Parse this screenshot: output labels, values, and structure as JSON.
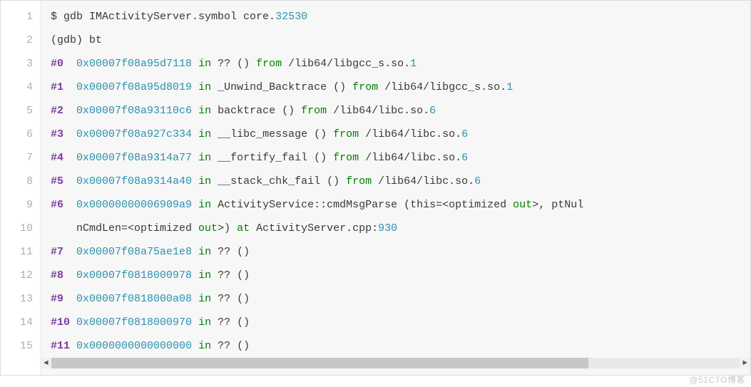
{
  "watermark": "@51CTO博客",
  "gutter": [
    "1",
    "2",
    "3",
    "4",
    "5",
    "6",
    "7",
    "8",
    "9",
    "10",
    "11",
    "12",
    "13",
    "14",
    "15"
  ],
  "lines": [
    {
      "tokens": [
        {
          "cls": "tok-plain",
          "txt": "$ gdb IMActivityServer.symbol core."
        },
        {
          "cls": "tok-num",
          "txt": "32530"
        }
      ]
    },
    {
      "tokens": [
        {
          "cls": "tok-plain",
          "txt": "(gdb) bt"
        }
      ]
    },
    {
      "tokens": [
        {
          "cls": "tok-frame",
          "txt": "#0"
        },
        {
          "cls": "tok-plain",
          "txt": "  "
        },
        {
          "cls": "tok-num",
          "txt": "0x00007f08a95d7118"
        },
        {
          "cls": "tok-plain",
          "txt": " "
        },
        {
          "cls": "tok-key",
          "txt": "in"
        },
        {
          "cls": "tok-plain",
          "txt": " ?? () "
        },
        {
          "cls": "tok-key",
          "txt": "from"
        },
        {
          "cls": "tok-plain",
          "txt": " /lib64/libgcc_s.so."
        },
        {
          "cls": "tok-num",
          "txt": "1"
        }
      ]
    },
    {
      "tokens": [
        {
          "cls": "tok-frame",
          "txt": "#1"
        },
        {
          "cls": "tok-plain",
          "txt": "  "
        },
        {
          "cls": "tok-num",
          "txt": "0x00007f08a95d8019"
        },
        {
          "cls": "tok-plain",
          "txt": " "
        },
        {
          "cls": "tok-key",
          "txt": "in"
        },
        {
          "cls": "tok-plain",
          "txt": " _Unwind_Backtrace () "
        },
        {
          "cls": "tok-key",
          "txt": "from"
        },
        {
          "cls": "tok-plain",
          "txt": " /lib64/libgcc_s.so."
        },
        {
          "cls": "tok-num",
          "txt": "1"
        }
      ]
    },
    {
      "tokens": [
        {
          "cls": "tok-frame",
          "txt": "#2"
        },
        {
          "cls": "tok-plain",
          "txt": "  "
        },
        {
          "cls": "tok-num",
          "txt": "0x00007f08a93110c6"
        },
        {
          "cls": "tok-plain",
          "txt": " "
        },
        {
          "cls": "tok-key",
          "txt": "in"
        },
        {
          "cls": "tok-plain",
          "txt": " backtrace () "
        },
        {
          "cls": "tok-key",
          "txt": "from"
        },
        {
          "cls": "tok-plain",
          "txt": " /lib64/libc.so."
        },
        {
          "cls": "tok-num",
          "txt": "6"
        }
      ]
    },
    {
      "tokens": [
        {
          "cls": "tok-frame",
          "txt": "#3"
        },
        {
          "cls": "tok-plain",
          "txt": "  "
        },
        {
          "cls": "tok-num",
          "txt": "0x00007f08a927c334"
        },
        {
          "cls": "tok-plain",
          "txt": " "
        },
        {
          "cls": "tok-key",
          "txt": "in"
        },
        {
          "cls": "tok-plain",
          "txt": " __libc_message () "
        },
        {
          "cls": "tok-key",
          "txt": "from"
        },
        {
          "cls": "tok-plain",
          "txt": " /lib64/libc.so."
        },
        {
          "cls": "tok-num",
          "txt": "6"
        }
      ]
    },
    {
      "tokens": [
        {
          "cls": "tok-frame",
          "txt": "#4"
        },
        {
          "cls": "tok-plain",
          "txt": "  "
        },
        {
          "cls": "tok-num",
          "txt": "0x00007f08a9314a77"
        },
        {
          "cls": "tok-plain",
          "txt": " "
        },
        {
          "cls": "tok-key",
          "txt": "in"
        },
        {
          "cls": "tok-plain",
          "txt": " __fortify_fail () "
        },
        {
          "cls": "tok-key",
          "txt": "from"
        },
        {
          "cls": "tok-plain",
          "txt": " /lib64/libc.so."
        },
        {
          "cls": "tok-num",
          "txt": "6"
        }
      ]
    },
    {
      "tokens": [
        {
          "cls": "tok-frame",
          "txt": "#5"
        },
        {
          "cls": "tok-plain",
          "txt": "  "
        },
        {
          "cls": "tok-num",
          "txt": "0x00007f08a9314a40"
        },
        {
          "cls": "tok-plain",
          "txt": " "
        },
        {
          "cls": "tok-key",
          "txt": "in"
        },
        {
          "cls": "tok-plain",
          "txt": " __stack_chk_fail () "
        },
        {
          "cls": "tok-key",
          "txt": "from"
        },
        {
          "cls": "tok-plain",
          "txt": " /lib64/libc.so."
        },
        {
          "cls": "tok-num",
          "txt": "6"
        }
      ]
    },
    {
      "tokens": [
        {
          "cls": "tok-frame",
          "txt": "#6"
        },
        {
          "cls": "tok-plain",
          "txt": "  "
        },
        {
          "cls": "tok-num",
          "txt": "0x00000000006909a9"
        },
        {
          "cls": "tok-plain",
          "txt": " "
        },
        {
          "cls": "tok-key",
          "txt": "in"
        },
        {
          "cls": "tok-plain",
          "txt": " ActivityService::cmdMsgParse (this=<optimized "
        },
        {
          "cls": "tok-out",
          "txt": "out"
        },
        {
          "cls": "tok-plain",
          "txt": ">, ptNul"
        }
      ]
    },
    {
      "tokens": [
        {
          "cls": "tok-plain",
          "txt": "    nCmdLen=<optimized "
        },
        {
          "cls": "tok-out",
          "txt": "out"
        },
        {
          "cls": "tok-plain",
          "txt": ">) "
        },
        {
          "cls": "tok-key",
          "txt": "at"
        },
        {
          "cls": "tok-plain",
          "txt": " ActivityServer.cpp:"
        },
        {
          "cls": "tok-num",
          "txt": "930"
        }
      ]
    },
    {
      "tokens": [
        {
          "cls": "tok-frame",
          "txt": "#7"
        },
        {
          "cls": "tok-plain",
          "txt": "  "
        },
        {
          "cls": "tok-num",
          "txt": "0x00007f08a75ae1e8"
        },
        {
          "cls": "tok-plain",
          "txt": " "
        },
        {
          "cls": "tok-key",
          "txt": "in"
        },
        {
          "cls": "tok-plain",
          "txt": " ?? ()"
        }
      ]
    },
    {
      "tokens": [
        {
          "cls": "tok-frame",
          "txt": "#8"
        },
        {
          "cls": "tok-plain",
          "txt": "  "
        },
        {
          "cls": "tok-num",
          "txt": "0x00007f0818000978"
        },
        {
          "cls": "tok-plain",
          "txt": " "
        },
        {
          "cls": "tok-key",
          "txt": "in"
        },
        {
          "cls": "tok-plain",
          "txt": " ?? ()"
        }
      ]
    },
    {
      "tokens": [
        {
          "cls": "tok-frame",
          "txt": "#9"
        },
        {
          "cls": "tok-plain",
          "txt": "  "
        },
        {
          "cls": "tok-num",
          "txt": "0x00007f0818000a08"
        },
        {
          "cls": "tok-plain",
          "txt": " "
        },
        {
          "cls": "tok-key",
          "txt": "in"
        },
        {
          "cls": "tok-plain",
          "txt": " ?? ()"
        }
      ]
    },
    {
      "tokens": [
        {
          "cls": "tok-frame",
          "txt": "#10"
        },
        {
          "cls": "tok-plain",
          "txt": " "
        },
        {
          "cls": "tok-num",
          "txt": "0x00007f0818000970"
        },
        {
          "cls": "tok-plain",
          "txt": " "
        },
        {
          "cls": "tok-key",
          "txt": "in"
        },
        {
          "cls": "tok-plain",
          "txt": " ?? ()"
        }
      ]
    },
    {
      "tokens": [
        {
          "cls": "tok-frame",
          "txt": "#11"
        },
        {
          "cls": "tok-plain",
          "txt": " "
        },
        {
          "cls": "tok-num",
          "txt": "0x0000000000000000"
        },
        {
          "cls": "tok-plain",
          "txt": " "
        },
        {
          "cls": "tok-key",
          "txt": "in"
        },
        {
          "cls": "tok-plain",
          "txt": " ?? ()"
        }
      ]
    }
  ]
}
